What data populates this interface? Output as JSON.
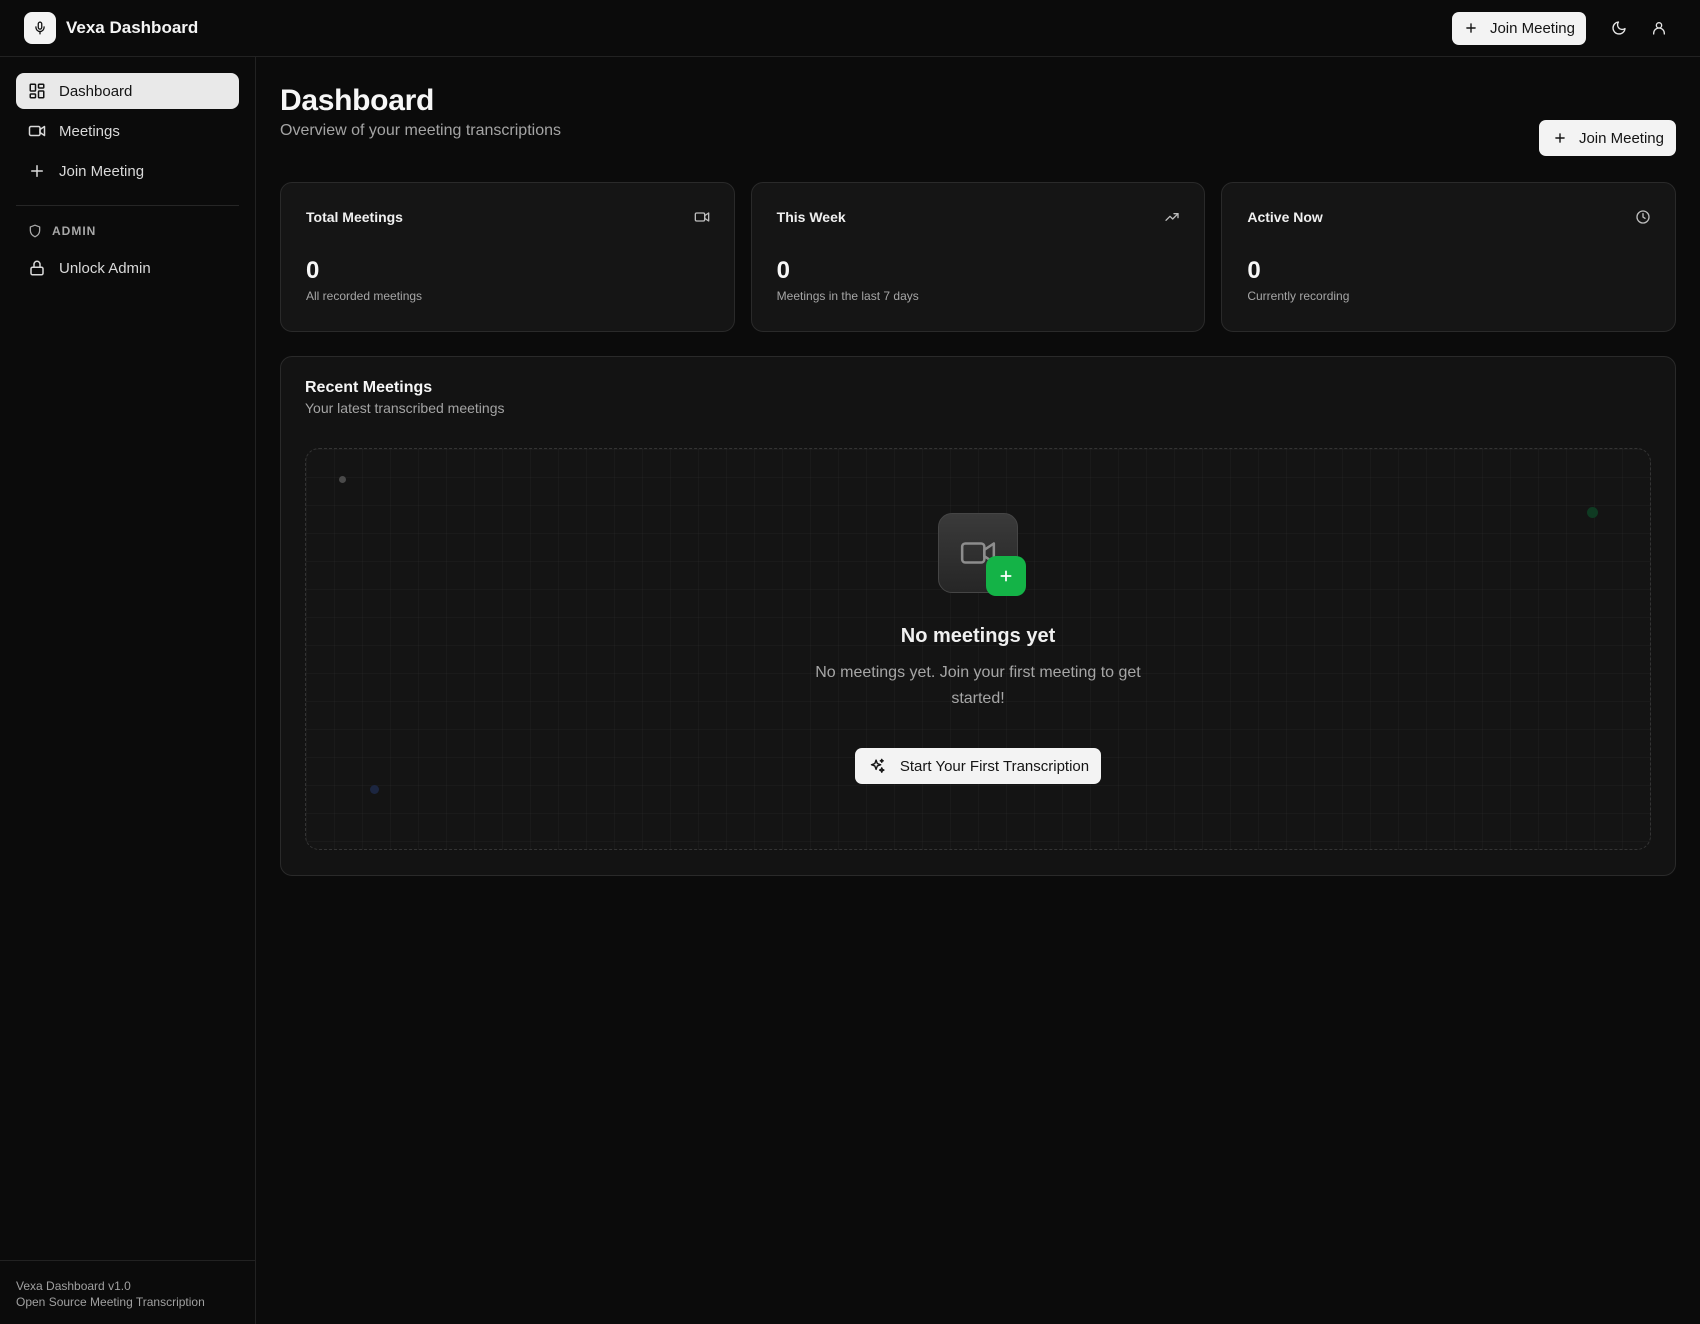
{
  "app": {
    "title": "Vexa Dashboard",
    "logo_icon": "microphone-icon"
  },
  "topbar": {
    "join_label": "Join Meeting",
    "theme_icon": "moon-icon",
    "user_icon": "user-icon"
  },
  "sidebar": {
    "items": [
      {
        "label": "Dashboard",
        "icon": "dashboard-icon",
        "active": true
      },
      {
        "label": "Meetings",
        "icon": "video-icon",
        "active": false
      },
      {
        "label": "Join Meeting",
        "icon": "plus-icon",
        "active": false
      }
    ],
    "admin_section": "ADMIN",
    "admin_item": "Unlock Admin",
    "footer": {
      "version": "Vexa Dashboard v1.0",
      "tagline": "Open Source Meeting Transcription"
    }
  },
  "main": {
    "title": "Dashboard",
    "subtitle": "Overview of your meeting transcriptions",
    "join_label": "Join Meeting",
    "stats": [
      {
        "label": "Total Meetings",
        "value": "0",
        "desc": "All recorded meetings",
        "icon": "video-icon"
      },
      {
        "label": "This Week",
        "value": "0",
        "desc": "Meetings in the last 7 days",
        "icon": "trending-up-icon"
      },
      {
        "label": "Active Now",
        "value": "0",
        "desc": "Currently recording",
        "icon": "clock-icon"
      }
    ],
    "recent": {
      "title": "Recent Meetings",
      "subtitle": "Your latest transcribed meetings",
      "empty_title": "No meetings yet",
      "empty_desc": "No meetings yet. Join your first meeting to get started!",
      "cta_label": "Start Your First Transcription",
      "accent_color": "#14b347"
    }
  }
}
